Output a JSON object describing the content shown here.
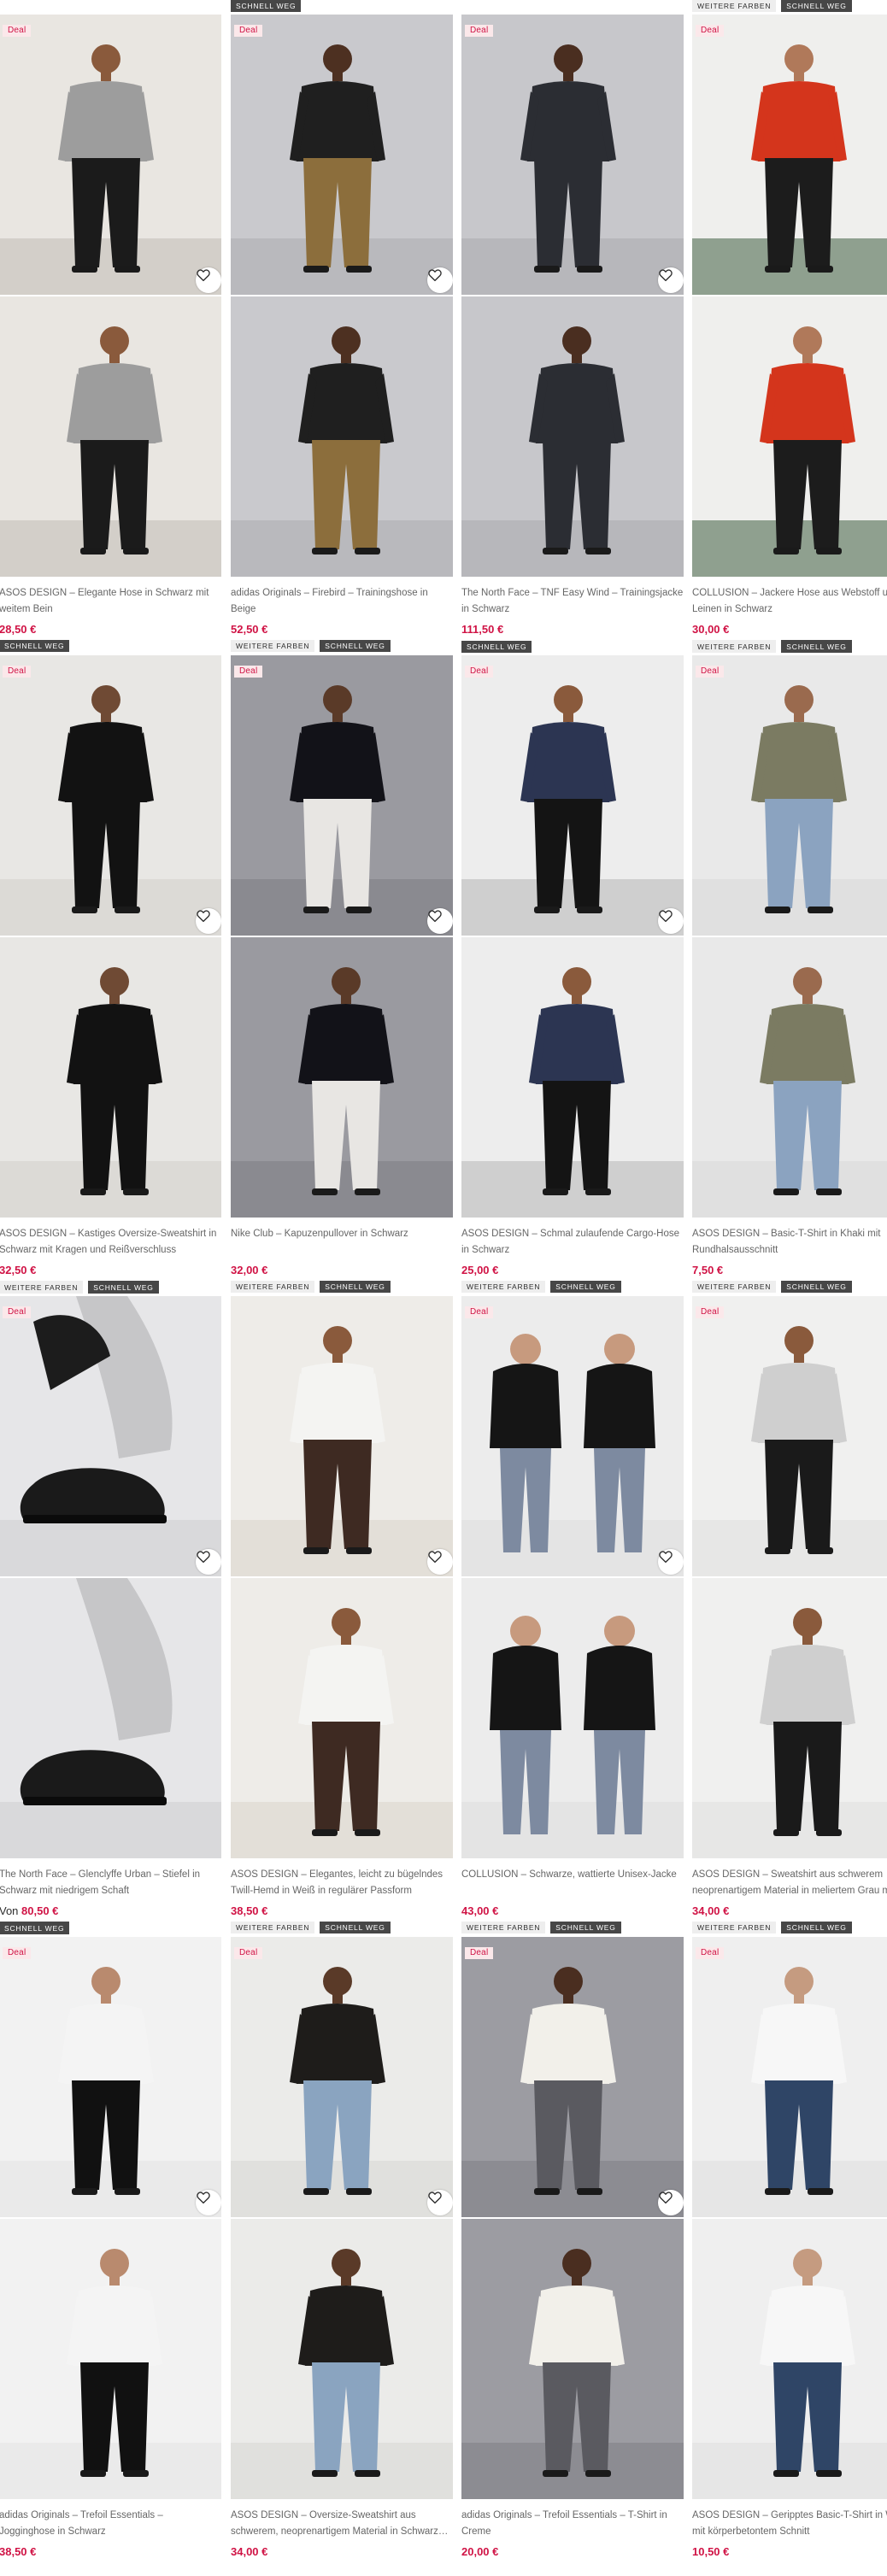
{
  "labels": {
    "deal": "Deal",
    "more_colours": "WEITERE FARBEN",
    "fast_delivery": "SCHNELL WEG",
    "from": "Von"
  },
  "colors": {
    "price": "#d01345",
    "deal_bg": "#fbe8ea",
    "dark_tag": "#474747",
    "light_tag": "#eeeeee"
  },
  "icons": {
    "save": "heart-outline-icon"
  },
  "products": [
    {
      "title": "ASOS DESIGN – Elegante Hose in Schwarz mit weitem Bein",
      "price": "28,50 €",
      "deal": true,
      "top_badges": [],
      "bottom_badges": [
        "fast_delivery"
      ],
      "bg": "#e9e6e1",
      "floor": "#d3cfc9",
      "garment": "#1b1b1b",
      "top": "#9d9d9d",
      "skin": "#8a5a3c",
      "pose": "stand"
    },
    {
      "title": "adidas Originals – Firebird – Trainingshose in Beige",
      "price": "52,50 €",
      "deal": true,
      "top_badges": [
        "fast_delivery"
      ],
      "bottom_badges": [
        "more_colours",
        "fast_delivery"
      ],
      "bg": "#c9c9cd",
      "floor": "#b9b9bd",
      "garment": "#8c6e3c",
      "top": "#1f1f1f",
      "skin": "#4d3021",
      "pose": "stand"
    },
    {
      "title": "The North Face – TNF Easy Wind – Trainingsjacke in Schwarz",
      "price": "111,50 €",
      "deal": true,
      "top_badges": [],
      "bottom_badges": [],
      "bg": "#c7c7cb",
      "floor": "#b7b7bb",
      "garment": "#2b2d33",
      "top": "#2b2d33",
      "skin": "#4a2e20",
      "pose": "stand"
    },
    {
      "title": "COLLUSION – Jackere Hose aus Webstoff und Leinen in Schwarz",
      "price": "30,00 €",
      "deal": true,
      "top_badges": [
        "more_colours",
        "fast_delivery"
      ],
      "bottom_badges": [
        "more_colours",
        "fast_delivery"
      ],
      "bg": "#efefed",
      "floor": "#8fa08f",
      "garment": "#1c1c1c",
      "top": "#d4351c",
      "skin": "#b0795a",
      "pose": "stand"
    },
    {
      "title": "ASOS DESIGN – Kastiges Oversize-Sweatshirt in Schwarz mit Kragen und Reißverschluss",
      "price": "32,50 €",
      "deal": true,
      "top_badges": [],
      "bottom_badges": [
        "more_colours",
        "fast_delivery"
      ],
      "bg": "#e8e7e4",
      "floor": "#dcdad6",
      "garment": "#121212",
      "top": "#121212",
      "skin": "#6f4a34",
      "pose": "stand"
    },
    {
      "title": "Nike Club – Kapuzenpullover in Schwarz",
      "price": "32,00 €",
      "deal": true,
      "top_badges": [],
      "bottom_badges": [
        "more_colours",
        "fast_delivery"
      ],
      "bg": "#9a9aa0",
      "floor": "#8a8a90",
      "garment": "#e8e6e3",
      "top": "#121218",
      "skin": "#5a3a28",
      "pose": "stand"
    },
    {
      "title": "ASOS DESIGN – Schmal zulaufende Cargo-Hose in Schwarz",
      "price": "25,00 €",
      "deal": true,
      "top_badges": [
        "fast_delivery"
      ],
      "bottom_badges": [
        "more_colours",
        "fast_delivery"
      ],
      "bg": "#ededed",
      "floor": "#cfcfcf",
      "garment": "#141414",
      "top": "#2c3552",
      "skin": "#8a5a3c",
      "pose": "stand"
    },
    {
      "title": "ASOS DESIGN – Basic-T-Shirt in Khaki mit Rundhalsausschnitt",
      "price": "7,50 €",
      "deal": true,
      "top_badges": [
        "more_colours",
        "fast_delivery"
      ],
      "bottom_badges": [
        "more_colours",
        "fast_delivery"
      ],
      "bg": "#e9e9e9",
      "floor": "#e0e0e0",
      "garment": "#8ba3c0",
      "top": "#7b7b62",
      "skin": "#9a6a4e",
      "pose": "stand"
    },
    {
      "title": "The North Face – Glenclyffe Urban – Stiefel in Schwarz mit niedrigem Schaft",
      "price": "80,50 €",
      "from": true,
      "deal": true,
      "top_badges": [
        "more_colours",
        "fast_delivery"
      ],
      "bottom_badges": [
        "fast_delivery"
      ],
      "bg": "#e6e6e8",
      "floor": "#d9d9db",
      "garment": "#c6c6c8",
      "top": "#1a1a1a",
      "skin": "#1a1a1a",
      "pose": "shoe"
    },
    {
      "title": "ASOS DESIGN – Elegantes, leicht zu bügelndes Twill-Hemd in Weiß in regulärer Passform",
      "price": "38,50 €",
      "deal": false,
      "top_badges": [],
      "bottom_badges": [
        "more_colours",
        "fast_delivery"
      ],
      "bg": "#eeece8",
      "floor": "#e3dfd8",
      "garment": "#3e2a22",
      "top": "#f4f4f2",
      "skin": "#8a5a3c",
      "pose": "stand"
    },
    {
      "title": "COLLUSION – Schwarze, wattierte Unisex-Jacke",
      "price": "43,00 €",
      "deal": true,
      "top_badges": [],
      "bottom_badges": [
        "more_colours",
        "fast_delivery"
      ],
      "bg": "#ececec",
      "floor": "#e4e4e4",
      "garment": "#7d8aa0",
      "top": "#151515",
      "skin": "#c79a7e",
      "pose": "duo"
    },
    {
      "title": "ASOS DESIGN – Sweatshirt aus schwerem neoprenartigem Material in meliertem Grau mit Rundhalsausschnitt",
      "price": "34,00 €",
      "deal": true,
      "top_badges": [],
      "bottom_badges": [
        "more_colours",
        "fast_delivery"
      ],
      "bg": "#f0f0ef",
      "floor": "#e7e7e6",
      "garment": "#1a1a1a",
      "top": "#cfcfcf",
      "skin": "#8a5a3c",
      "pose": "stand"
    },
    {
      "title": "adidas Originals – Trefoil Essentials – Jogginghose in Schwarz",
      "price": "38,50 €",
      "deal": true,
      "top_badges": [
        "fast_delivery"
      ],
      "bottom_badges": [],
      "bg": "#f2f2f2",
      "floor": "#eaeaea",
      "garment": "#111111",
      "top": "#f4f4f4",
      "skin": "#b98a6e",
      "pose": "stand"
    },
    {
      "title": "ASOS DESIGN – Oversize-Sweatshirt aus schwerem, neoprenartigem Material in Schwarz mit Reißverschluss",
      "price": "34,00 €",
      "deal": true,
      "top_badges": [],
      "bottom_badges": [],
      "bg": "#ebebe9",
      "floor": "#e0e0dd",
      "garment": "#8aa4c0",
      "top": "#1e1c1a",
      "skin": "#5a3a28",
      "pose": "stand"
    },
    {
      "title": "adidas Originals – Trefoil Essentials – T-Shirt in Creme",
      "price": "20,00 €",
      "deal": true,
      "top_badges": [],
      "bottom_badges": [],
      "bg": "#9c9ca2",
      "floor": "#8c8c92",
      "garment": "#5a5a60",
      "top": "#f2f0ea",
      "skin": "#4a2e20",
      "pose": "stand"
    },
    {
      "title": "ASOS DESIGN – Geripptes Basic-T-Shirt in Weiß mit körperbetontem Schnitt",
      "price": "10,50 €",
      "deal": true,
      "top_badges": [],
      "bottom_badges": [],
      "bg": "#efefef",
      "floor": "#e6e6e6",
      "garment": "#2f4566",
      "top": "#f7f7f7",
      "skin": "#c59b80",
      "pose": "stand"
    }
  ]
}
